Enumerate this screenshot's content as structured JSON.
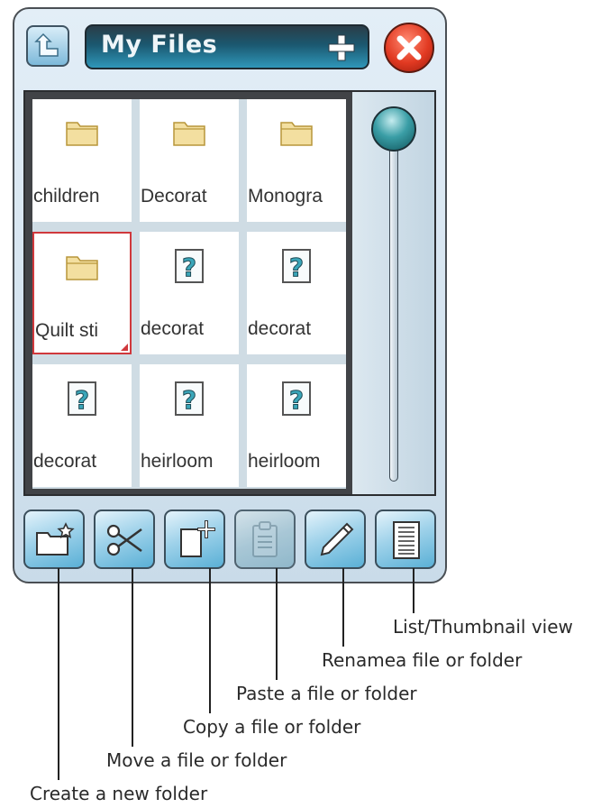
{
  "header": {
    "title": "My Files",
    "up_icon": "up-folder-icon",
    "add_icon": "plus-icon",
    "close_icon": "close-icon"
  },
  "files": [
    {
      "label": "children",
      "icon": "folder-icon",
      "selected": false
    },
    {
      "label": "Decorat",
      "icon": "folder-icon",
      "selected": false
    },
    {
      "label": "Monogra",
      "icon": "folder-icon",
      "selected": false
    },
    {
      "label": "Quilt sti",
      "icon": "folder-icon",
      "selected": true
    },
    {
      "label": "decorat",
      "icon": "unknown-file-icon",
      "selected": false
    },
    {
      "label": "decorat",
      "icon": "unknown-file-icon",
      "selected": false
    },
    {
      "label": "decorat",
      "icon": "unknown-file-icon",
      "selected": false
    },
    {
      "label": "heirloom",
      "icon": "unknown-file-icon",
      "selected": false
    },
    {
      "label": "heirloom",
      "icon": "unknown-file-icon",
      "selected": false
    }
  ],
  "toolbar": [
    {
      "icon": "new-folder-icon",
      "enabled": true
    },
    {
      "icon": "scissors-icon",
      "enabled": true
    },
    {
      "icon": "copy-icon",
      "enabled": true
    },
    {
      "icon": "paste-icon",
      "enabled": false
    },
    {
      "icon": "pencil-icon",
      "enabled": true
    },
    {
      "icon": "list-view-icon",
      "enabled": true
    }
  ],
  "callouts": {
    "list_view": "List/Thumbnail view",
    "rename": "Renamea file or folder",
    "paste": "Paste a file or folder",
    "copy": "Copy a file or folder",
    "move": "Move a file or folder",
    "create": "Create a new folder"
  },
  "colors": {
    "selection": "#d0383c",
    "title_bar": "#1b5870",
    "button_accent": "#5ab0d6",
    "folder": "#f3dfa0",
    "question": "#3aa6b9"
  }
}
